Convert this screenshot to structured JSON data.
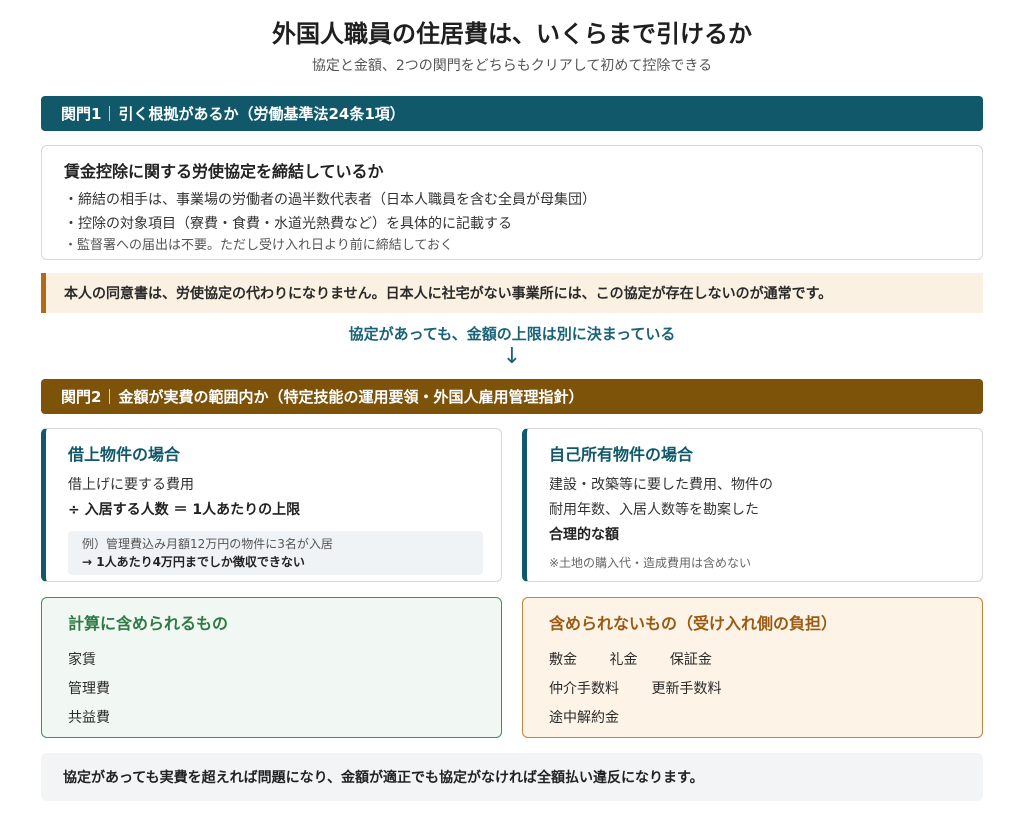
{
  "header": {
    "title": "外国人職員の住居費は、いくらまで引けるか",
    "subtitle": "協定と金額、2つの関門をどちらもクリアして初めて控除できる"
  },
  "gate1": {
    "label": "関門1",
    "text": "引く根拠があるか（労働基準法24条1項）"
  },
  "agreement": {
    "heading": "賃金控除に関する労使協定を締結しているか",
    "items": [
      "・締結の相手は、事業場の労働者の過半数代表者（日本人職員を含む全員が母集団）",
      "・控除の対象項目（寮費・食費・水道光熱費など）を具体的に記載する",
      "・監督署への届出は不要。ただし受け入れ日より前に締結しておく"
    ]
  },
  "note": "本人の同意書は、労使協定の代わりになりません。日本人に社宅がない事業所には、この協定が存在しないのが通常です。",
  "connector": {
    "text": "協定があっても、金額の上限は別に決まっている",
    "arrow": "↓"
  },
  "gate2": {
    "label": "関門2",
    "text": "金額が実費の範囲内か（特定技能の運用要領・外国人雇用管理指針）"
  },
  "leased": {
    "heading": "借上物件の場合",
    "line1": "借上げに要する費用",
    "line2": "÷ 入居する人数 ＝ 1人あたりの上限",
    "example1": "例）管理費込み月額12万円の物件に3名が入居",
    "example2": "→ 1人あたり4万円までしか徴収できない"
  },
  "owned": {
    "heading": "自己所有物件の場合",
    "line1": "建設・改築等に要した費用、物件の",
    "line2": "耐用年数、入居人数等を勘案した",
    "line3": "合理的な額",
    "note": "※土地の購入代・造成費用は含めない"
  },
  "included": {
    "heading": "計算に含められるもの",
    "items": [
      "家賃",
      "管理費",
      "共益費"
    ]
  },
  "excluded": {
    "heading": "含められないもの（受け入れ側の負担）",
    "row1": [
      "敷金",
      "礼金",
      "保証金"
    ],
    "row2": [
      "仲介手数料",
      "更新手数料"
    ],
    "row3": [
      "途中解約金"
    ]
  },
  "footer": "協定があっても実費を超えれば問題になり、金額が適正でも協定がなければ全額払い違反になります。",
  "colors": {
    "gate1": "#11596a",
    "gate2": "#7d5209",
    "included_accent": "#2f7a44",
    "excluded_accent": "#9a5a12"
  }
}
